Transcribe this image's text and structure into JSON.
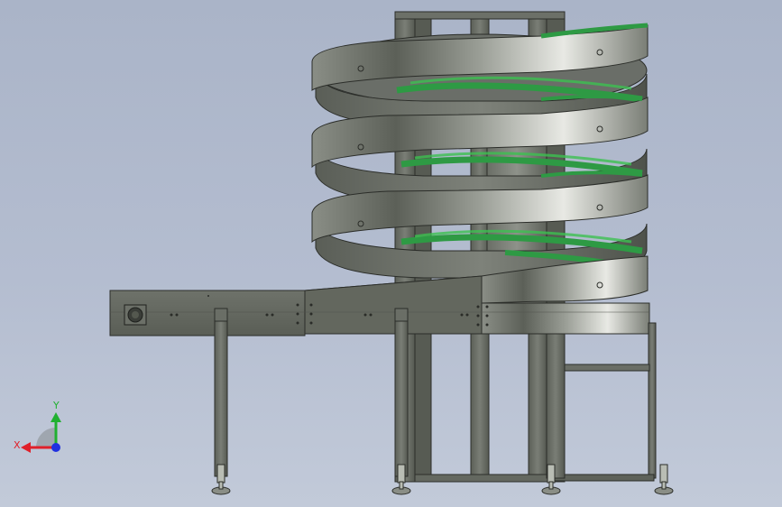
{
  "viewport": {
    "background_top": "#aab4c8",
    "background_bottom": "#c2cad9"
  },
  "model": {
    "description_icon": "spiral-conveyor-model",
    "belt_color": "#2e9a44",
    "frame_color": "#6a6f66"
  },
  "triad": {
    "x_label": "X",
    "y_label": "Y",
    "x_color": "#e0202a",
    "y_color": "#20b030",
    "z_color": "#2030e0"
  }
}
